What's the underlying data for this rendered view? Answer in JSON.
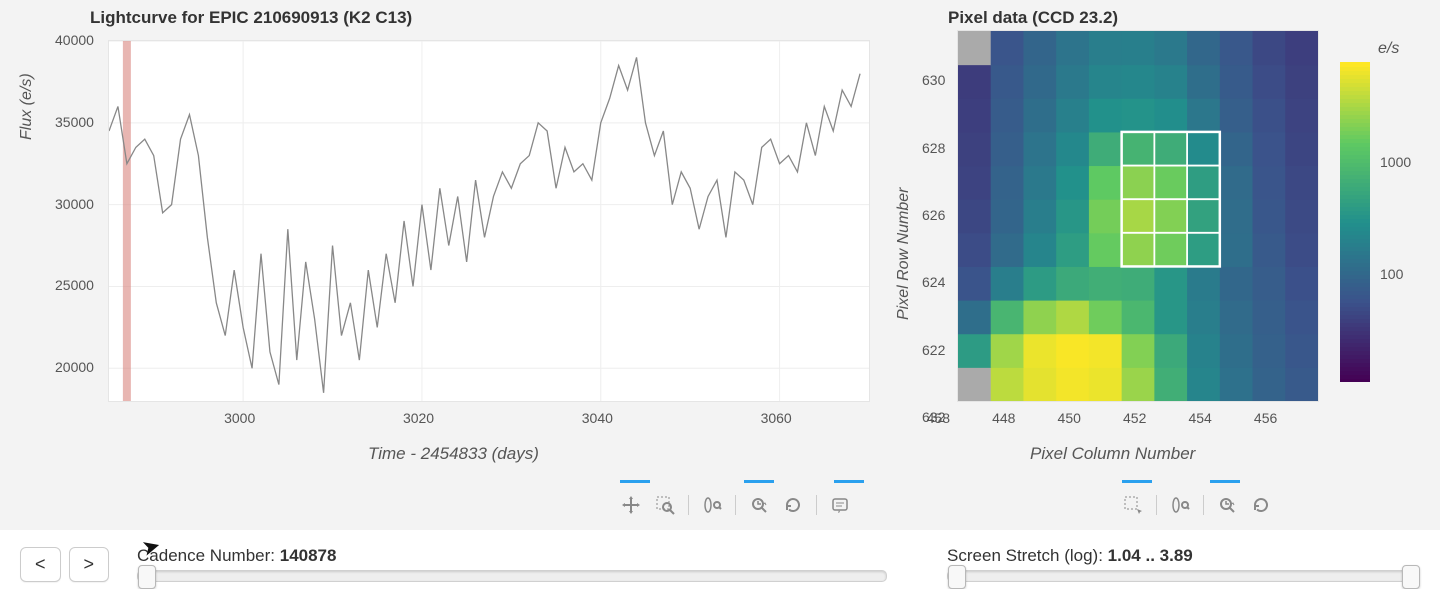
{
  "lightcurve": {
    "title": "Lightcurve for EPIC 210690913 (K2 C13)",
    "ylabel": "Flux (e/s)",
    "xlabel": "Time - 2454833 (days)",
    "yticks": [
      20000,
      25000,
      30000,
      35000,
      40000
    ],
    "xticks": [
      3000,
      3020,
      3040,
      3060
    ],
    "cursor_x": 2987
  },
  "pixel": {
    "title": "Pixel data (CCD 23.2)",
    "ylabel": "Pixel Row Number",
    "xlabel": "Pixel Column Number",
    "cbar_title": "e/s",
    "cbar_ticks": [
      100,
      1000
    ],
    "xticks": [
      448,
      450,
      452,
      454,
      456,
      458
    ],
    "yticks": [
      622,
      624,
      626,
      628,
      630,
      632
    ],
    "aperture": {
      "col": [
        452,
        454
      ],
      "row": [
        625,
        628
      ]
    }
  },
  "toolbar": {
    "pan": "pan-icon",
    "box_zoom": "box-zoom-icon",
    "wheel_zoom": "wheel-zoom-icon",
    "tap": "tap-icon",
    "reset": "reset-icon",
    "hover": "hover-icon",
    "box_select": "box-select-icon"
  },
  "controls": {
    "prev": "<",
    "next": ">",
    "cadence_label": "Cadence Number:",
    "cadence_value": "140878",
    "cadence_min": 0,
    "cadence_max": 100,
    "cadence_pos": 0,
    "stretch_label": "Screen Stretch (log):",
    "stretch_value": "1.04 .. 3.89",
    "stretch_low_pos": 0,
    "stretch_high_pos": 100
  },
  "chart_data": [
    {
      "type": "line",
      "name": "lightcurve",
      "title": "Lightcurve for EPIC 210690913 (K2 C13)",
      "xlabel": "Time - 2454833 (days)",
      "ylabel": "Flux (e/s)",
      "xlim": [
        2985,
        3070
      ],
      "ylim": [
        18000,
        40000
      ],
      "cursor_x": 2987,
      "x": [
        2985,
        2986,
        2987,
        2988,
        2989,
        2990,
        2991,
        2992,
        2993,
        2994,
        2995,
        2996,
        2997,
        2998,
        2999,
        3000,
        3001,
        3002,
        3003,
        3004,
        3005,
        3006,
        3007,
        3008,
        3009,
        3010,
        3011,
        3012,
        3013,
        3014,
        3015,
        3016,
        3017,
        3018,
        3019,
        3020,
        3021,
        3022,
        3023,
        3024,
        3025,
        3026,
        3027,
        3028,
        3029,
        3030,
        3031,
        3032,
        3033,
        3034,
        3035,
        3036,
        3037,
        3038,
        3039,
        3040,
        3041,
        3042,
        3043,
        3044,
        3045,
        3046,
        3047,
        3048,
        3049,
        3050,
        3051,
        3052,
        3053,
        3054,
        3055,
        3056,
        3057,
        3058,
        3059,
        3060,
        3061,
        3062,
        3063,
        3064,
        3065,
        3066,
        3067,
        3068,
        3069
      ],
      "y": [
        34500,
        36000,
        32500,
        33500,
        34000,
        33000,
        29500,
        30000,
        34000,
        35500,
        33000,
        28000,
        24000,
        22000,
        26000,
        22500,
        20000,
        27000,
        21000,
        19000,
        28500,
        20500,
        26500,
        23000,
        18500,
        27500,
        22000,
        24000,
        20500,
        26000,
        22500,
        27000,
        24000,
        29000,
        25000,
        30000,
        26000,
        31000,
        27500,
        30500,
        26500,
        31500,
        28000,
        30500,
        32000,
        31000,
        32500,
        33000,
        35000,
        34500,
        31000,
        33500,
        32000,
        32500,
        31500,
        35000,
        36500,
        38500,
        37000,
        39000,
        35000,
        33000,
        34500,
        30000,
        32000,
        31000,
        28500,
        30500,
        31500,
        28000,
        32000,
        31500,
        30000,
        33500,
        34000,
        32500,
        33000,
        32000,
        35000,
        33000,
        36000,
        34500,
        37000,
        36000,
        38000
      ]
    },
    {
      "type": "heatmap",
      "name": "pixel_data",
      "title": "Pixel data (CCD 23.2)",
      "xlabel": "Pixel Column Number",
      "ylabel": "Pixel Row Number",
      "xlim": [
        447,
        458
      ],
      "ylim": [
        621,
        632
      ],
      "colormap": "viridis",
      "colorbar_scale": "log",
      "colorbar_label": "e/s",
      "colorbar_range": [
        11,
        7800
      ],
      "x": [
        447,
        448,
        449,
        450,
        451,
        452,
        453,
        454,
        455,
        456,
        457
      ],
      "y": [
        621,
        622,
        623,
        624,
        625,
        626,
        627,
        628,
        629,
        630,
        631
      ],
      "z": [
        [
          null,
          4000,
          6000,
          7000,
          6500,
          2800,
          700,
          220,
          130,
          90,
          70
        ],
        [
          400,
          3000,
          6500,
          7500,
          7000,
          2200,
          600,
          200,
          120,
          85,
          65
        ],
        [
          120,
          850,
          2500,
          3500,
          1800,
          900,
          350,
          180,
          110,
          80,
          60
        ],
        [
          60,
          180,
          400,
          600,
          700,
          650,
          350,
          170,
          100,
          75,
          55
        ],
        [
          50,
          110,
          220,
          420,
          1600,
          2500,
          1800,
          420,
          120,
          70,
          50
        ],
        [
          45,
          95,
          180,
          350,
          1900,
          3200,
          2200,
          480,
          115,
          65,
          48
        ],
        [
          42,
          88,
          160,
          300,
          1500,
          2400,
          1700,
          430,
          110,
          62,
          46
        ],
        [
          40,
          80,
          140,
          240,
          650,
          800,
          650,
          260,
          95,
          58,
          44
        ],
        [
          38,
          74,
          120,
          190,
          300,
          320,
          280,
          150,
          80,
          54,
          42
        ],
        [
          36,
          68,
          105,
          160,
          220,
          230,
          200,
          120,
          72,
          50,
          40
        ],
        [
          null,
          62,
          95,
          140,
          180,
          185,
          160,
          100,
          66,
          46,
          38
        ]
      ],
      "aperture_mask": {
        "col_range": [
          452,
          454
        ],
        "row_range": [
          625,
          628
        ]
      }
    }
  ]
}
